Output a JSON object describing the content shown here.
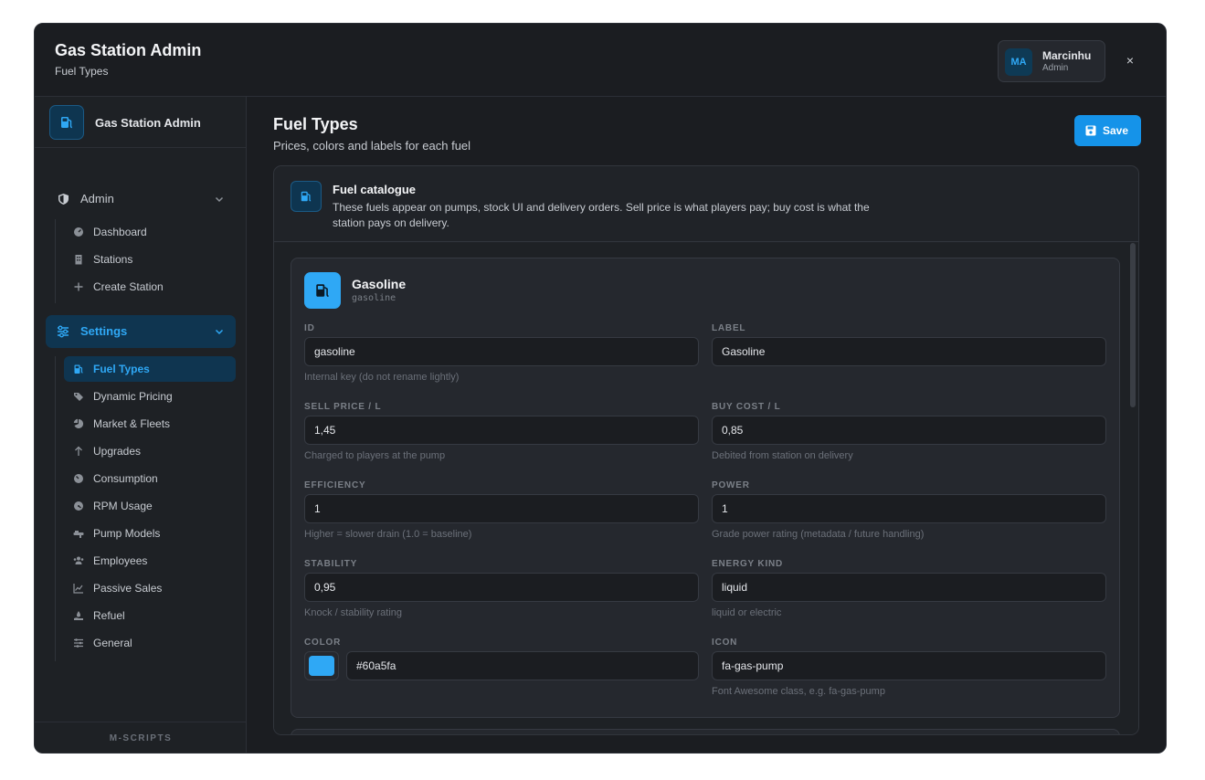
{
  "header": {
    "title": "Gas Station Admin",
    "subtitle": "Fuel Types"
  },
  "user": {
    "initials": "MA",
    "name": "Marcinhu",
    "role": "Admin"
  },
  "close_label": "×",
  "sidebar": {
    "brand": "Gas Station Admin",
    "groups": [
      {
        "label": "Admin",
        "icon": "shield-icon",
        "items": [
          {
            "label": "Dashboard",
            "icon": "gauge-icon"
          },
          {
            "label": "Stations",
            "icon": "building-icon"
          },
          {
            "label": "Create Station",
            "icon": "plus-icon"
          }
        ]
      },
      {
        "label": "Settings",
        "icon": "sliders-icon",
        "items": [
          {
            "label": "Fuel Types",
            "icon": "gas-pump-icon"
          },
          {
            "label": "Dynamic Pricing",
            "icon": "tags-icon"
          },
          {
            "label": "Market & Fleets",
            "icon": "pie-chart-icon"
          },
          {
            "label": "Upgrades",
            "icon": "arrow-up-icon"
          },
          {
            "label": "Consumption",
            "icon": "gauge-icon"
          },
          {
            "label": "RPM Usage",
            "icon": "tachometer-icon"
          },
          {
            "label": "Pump Models",
            "icon": "pump-model-icon"
          },
          {
            "label": "Employees",
            "icon": "users-icon"
          },
          {
            "label": "Passive Sales",
            "icon": "line-chart-icon"
          },
          {
            "label": "Refuel",
            "icon": "hand-holding-icon"
          },
          {
            "label": "General",
            "icon": "sliders-icon"
          }
        ]
      }
    ],
    "footer": "M-SCRIPTS"
  },
  "main": {
    "title": "Fuel Types",
    "subtitle": "Prices, colors and labels for each fuel",
    "save_label": "Save"
  },
  "panel": {
    "title": "Fuel catalogue",
    "description": "These fuels appear on pumps, stock UI and delivery orders. Sell price is what players pay; buy cost is what the station pays on delivery."
  },
  "fuel": {
    "name": "Gasoline",
    "key": "gasoline",
    "fields": {
      "id": {
        "label": "ID",
        "value": "gasoline",
        "help": "Internal key (do not rename lightly)"
      },
      "label": {
        "label": "LABEL",
        "value": "Gasoline",
        "help": ""
      },
      "sell_price": {
        "label": "SELL PRICE / L",
        "value": "1,45",
        "help": "Charged to players at the pump"
      },
      "buy_cost": {
        "label": "BUY COST / L",
        "value": "0,85",
        "help": "Debited from station on delivery"
      },
      "efficiency": {
        "label": "EFFICIENCY",
        "value": "1",
        "help": "Higher = slower drain (1.0 = baseline)"
      },
      "power": {
        "label": "POWER",
        "value": "1",
        "help": "Grade power rating (metadata / future handling)"
      },
      "stability": {
        "label": "STABILITY",
        "value": "0,95",
        "help": "Knock / stability rating"
      },
      "energy_kind": {
        "label": "ENERGY KIND",
        "value": "liquid",
        "help": "liquid or electric"
      },
      "color": {
        "label": "COLOR",
        "value": "#60a5fa",
        "help": ""
      },
      "icon": {
        "label": "ICON",
        "value": "fa-gas-pump",
        "help": "Font Awesome class, e.g. fa-gas-pump"
      }
    }
  },
  "colors": {
    "accent": "#1593e9",
    "accent_text": "#2fa8f5",
    "swatch": "#2fa8f5"
  }
}
